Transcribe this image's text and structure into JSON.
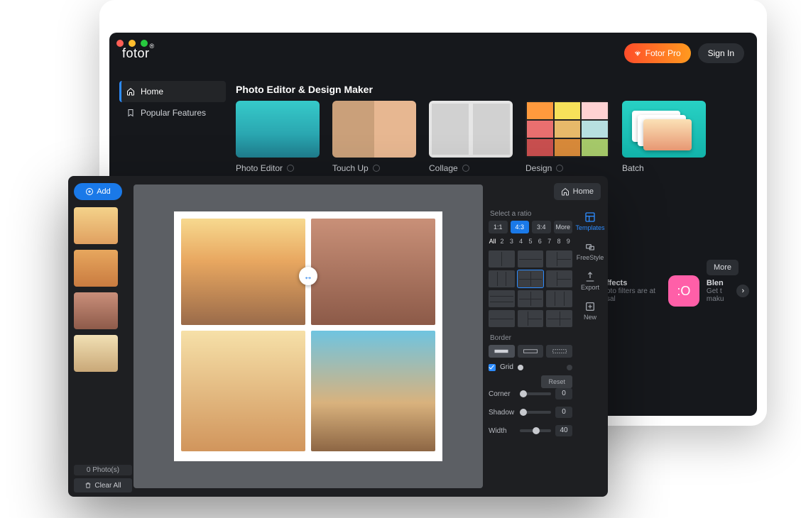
{
  "home": {
    "logo": "fotor",
    "pro_button": "Fotor Pro",
    "signin_button": "Sign In",
    "nav": {
      "home": "Home",
      "popular": "Popular Features"
    },
    "section_title": "Photo Editor & Design Maker",
    "cards": {
      "editor": "Photo Editor",
      "touchup": "Touch Up",
      "collage": "Collage",
      "design": "Design",
      "batch": "Batch"
    },
    "more": "More",
    "promo_effects": {
      "title": "ffects",
      "sub1": "oto filters are at",
      "sub2": "sal"
    },
    "promo_blen": {
      "title": "Blen",
      "sub": "Get t",
      "sub2": "maku"
    }
  },
  "editor": {
    "add": "Add",
    "home": "Home",
    "photo_count": "0 Photo(s)",
    "clear_all": "Clear All",
    "right_strip": {
      "templates": "Templates",
      "freestyle": "FreeStyle",
      "export": "Export",
      "new": "New"
    },
    "panel": {
      "ratio_label": "Select a ratio",
      "ratios": {
        "r11": "1:1",
        "r43": "4:3",
        "r34": "3:4",
        "more": "More"
      },
      "nums": {
        "all": "All",
        "n2": "2",
        "n3": "3",
        "n4": "4",
        "n5": "5",
        "n6": "6",
        "n7": "7",
        "n8": "8",
        "n9": "9"
      },
      "border": "Border",
      "grid": "Grid",
      "reset": "Reset",
      "corner_label": "Corner",
      "corner_val": "0",
      "shadow_label": "Shadow",
      "shadow_val": "0",
      "width_label": "Width",
      "width_val": "40"
    }
  }
}
